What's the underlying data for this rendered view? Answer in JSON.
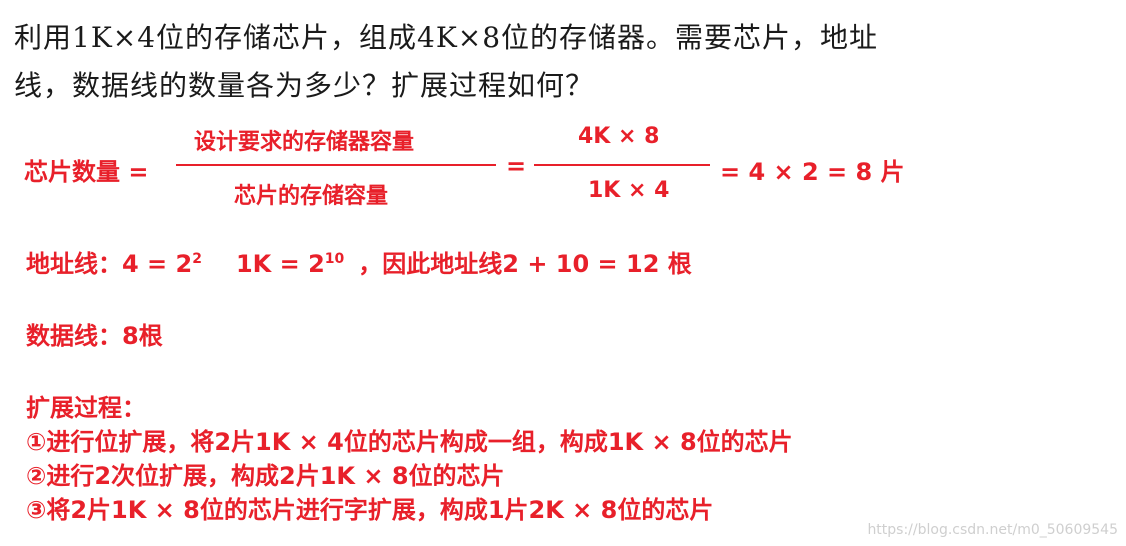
{
  "question": {
    "line1": "利用1K×4位的存储芯片，组成4K×8位的存储器。需要芯片，地址",
    "line2": "线，数据线的数量各为多少？扩展过程如何？"
  },
  "formula": {
    "lhs": "芯片数量 =",
    "num1": "设计要求的存储器容量",
    "den1": "芯片的存储容量",
    "eq1": "=",
    "num2": "4K × 8",
    "den2": "1K × 4",
    "result": "= 4 × 2 = 8 片"
  },
  "address": {
    "part1": "地址线：4 = 2",
    "exp1": "2",
    "part2": "1K = 2",
    "exp2": "10",
    "part3": "，因此地址线2 + 10 = 12 根"
  },
  "data_lines": "数据线：8根",
  "expansion": {
    "title": "扩展过程：",
    "steps": [
      "①进行位扩展，将2片1K × 4位的芯片构成一组，构成1K × 8位的芯片",
      "②进行2次位扩展，构成2片1K × 8位的芯片",
      "③将2片1K × 8位的芯片进行字扩展，构成1片2K × 8位的芯片"
    ]
  },
  "watermark": "https://blog.csdn.net/m0_50609545"
}
